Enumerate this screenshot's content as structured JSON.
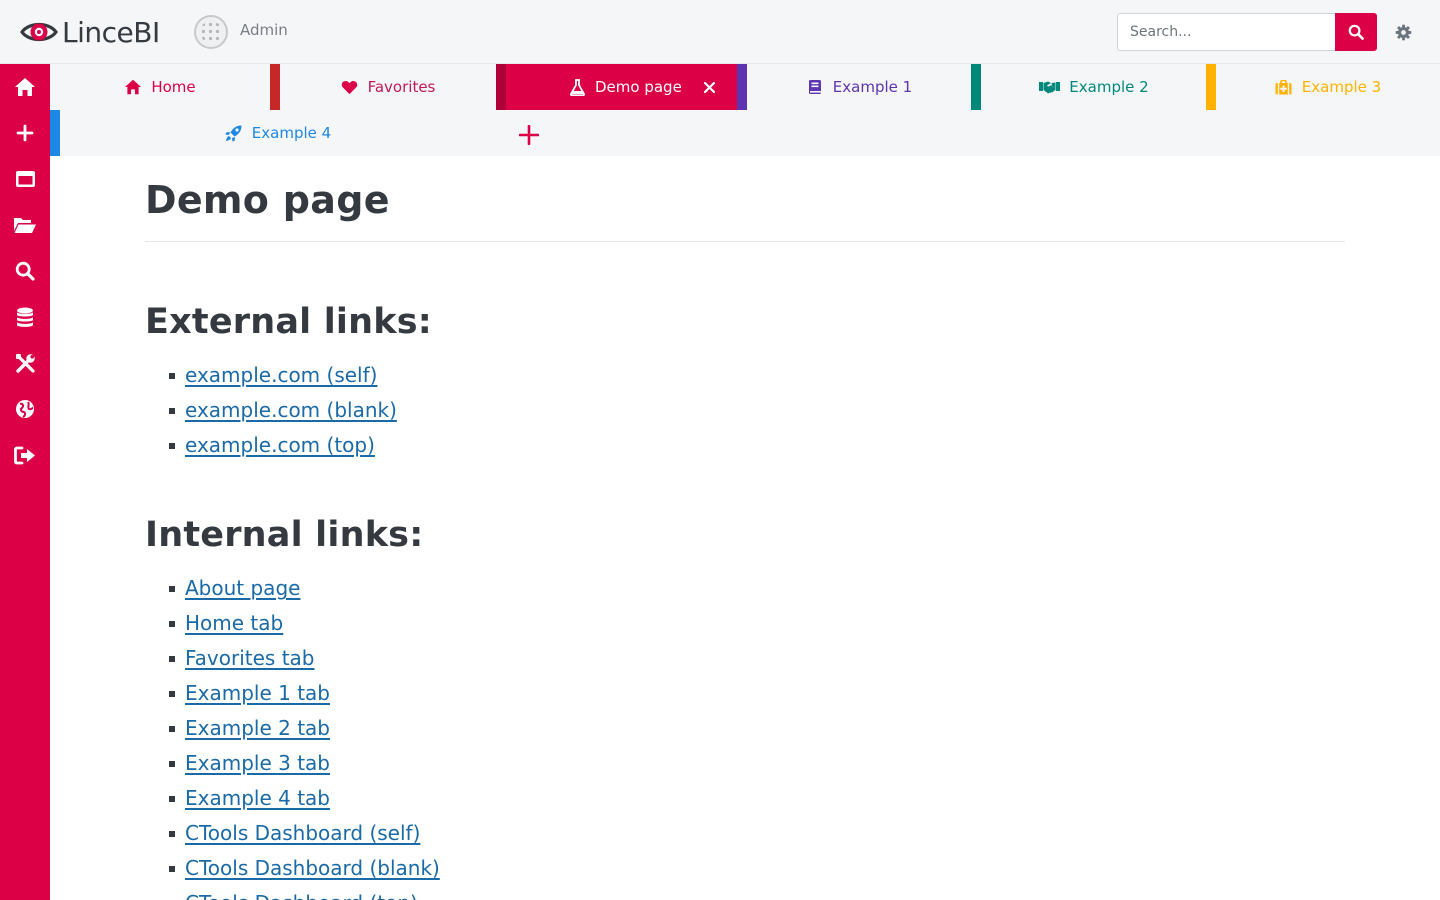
{
  "app": {
    "name": "LinceBI",
    "user": "Admin"
  },
  "search": {
    "placeholder": "Search..."
  },
  "colors": {
    "brand": "#dc0046",
    "link": "#1a6aa8"
  },
  "sidebar": {
    "items": [
      {
        "icon": "home-icon"
      },
      {
        "icon": "plus-icon"
      },
      {
        "icon": "window-icon"
      },
      {
        "icon": "folder-open-icon"
      },
      {
        "icon": "search-icon"
      },
      {
        "icon": "database-icon"
      },
      {
        "icon": "tools-icon"
      },
      {
        "icon": "globe-icon"
      },
      {
        "icon": "sign-out-icon"
      }
    ]
  },
  "tabs": [
    {
      "label": "Home",
      "icon": "home-icon",
      "color": "#dc0046"
    },
    {
      "label": "Favorites",
      "icon": "heart-icon",
      "color": "#c2185b"
    },
    {
      "label": "Demo page",
      "icon": "flask-icon",
      "color": "#ffffff",
      "active": true
    },
    {
      "label": "Example 1",
      "icon": "book-icon",
      "color": "#5e35b1"
    },
    {
      "label": "Example 2",
      "icon": "handshake-icon",
      "color": "#00897b"
    },
    {
      "label": "Example 3",
      "icon": "medkit-icon",
      "color": "#ffb300"
    },
    {
      "label": "Example 4",
      "icon": "rocket-icon",
      "color": "#1e88e5"
    }
  ],
  "content": {
    "title": "Demo page",
    "external_title": "External links:",
    "external_links": [
      "example.com (self)",
      "example.com (blank)",
      "example.com (top)"
    ],
    "internal_title": "Internal links:",
    "internal_links": [
      "About page",
      "Home tab",
      "Favorites tab",
      "Example 1 tab",
      "Example 2 tab",
      "Example 3 tab",
      "Example 4 tab",
      "CTools Dashboard (self)",
      "CTools Dashboard (blank)",
      "CTools Dashboard (top)"
    ]
  }
}
